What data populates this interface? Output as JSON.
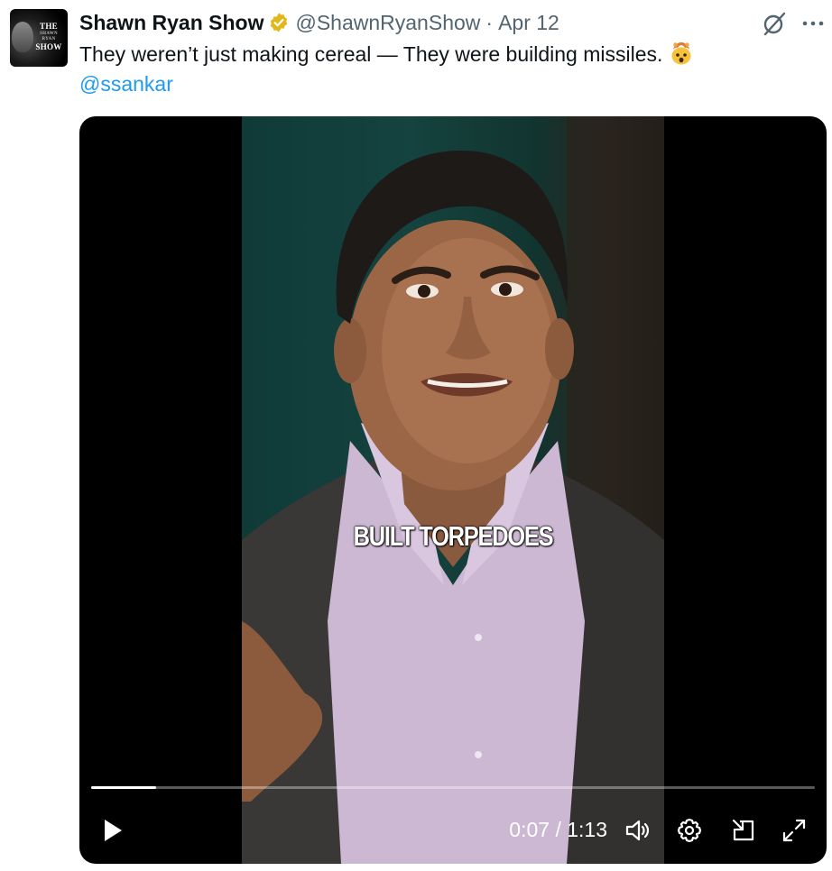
{
  "tweet": {
    "display_name": "Shawn Ryan Show",
    "handle": "@ShawnRyanShow",
    "separator": "·",
    "date": "Apr 12",
    "text": "They weren’t just making cereal — They were building missiles.",
    "emoji_icon": "exploding-head-emoji",
    "mention": "@ssankar",
    "avatar": {
      "top": "THE",
      "middle": "SHAWN RYAN",
      "bottom": "SHOW"
    }
  },
  "video": {
    "caption": "BUILT TORPEDOES",
    "current_time": "0:07",
    "separator": "/",
    "duration": "1:13",
    "progress_fraction": 0.09
  },
  "icons": {
    "verified": "verified-badge-icon",
    "grok": "grok-icon",
    "more": "more-icon",
    "play": "play-icon",
    "volume": "volume-icon",
    "settings": "settings-icon",
    "pip": "picture-in-picture-icon",
    "fullscreen": "fullscreen-icon"
  },
  "colors": {
    "text": "#0f1419",
    "secondary_text": "#536471",
    "link": "#1d9bf0",
    "verified_gold": "#e2b719",
    "video_bg": "#000000"
  }
}
